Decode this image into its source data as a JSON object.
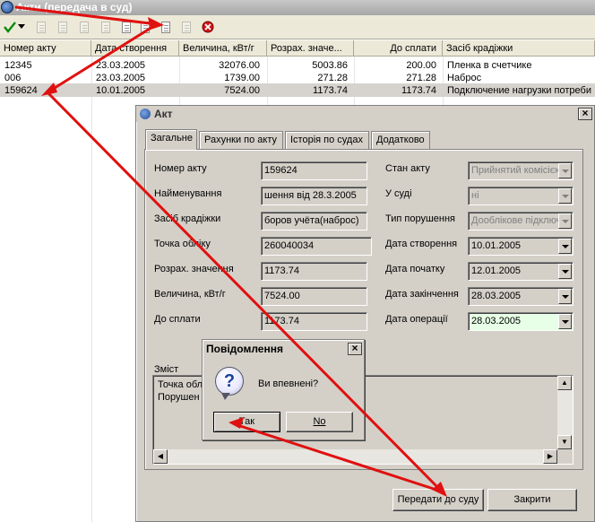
{
  "main_window": {
    "title": "Акти (передача в суд)"
  },
  "toolbar": {
    "icons": [
      "apply-check-icon",
      "chevron-down-icon",
      "new-document-icon",
      "edit-document-icon",
      "copy-document-icon",
      "delete-document-icon",
      "print-icon",
      "refresh-icon",
      "export-icon",
      "properties-icon",
      "close-red-icon"
    ]
  },
  "grid": {
    "columns": [
      "Номер акту",
      "Дата створення",
      "Величина, кВт/г",
      "Розрах. значе...",
      "До сплати",
      "Засіб крадіжки"
    ],
    "rows": [
      [
        "12345",
        "23.03.2005",
        "32076.00",
        "5003.86",
        "200.00",
        "Пленка в счетчике"
      ],
      [
        "006",
        "23.03.2005",
        "1739.00",
        "271.28",
        "271.28",
        "Наброс"
      ],
      [
        "159624",
        "10.01.2005",
        "7524.00",
        "1173.74",
        "1173.74",
        "Подключение нагрузки потреби"
      ]
    ]
  },
  "dialog": {
    "title": "Акт",
    "close": "×",
    "tabs": [
      "Загальне",
      "Рахунки по акту",
      "Історія по судах",
      "Додатково"
    ],
    "left_fields": [
      {
        "label": "Номер акту",
        "value": "159624"
      },
      {
        "label": "Найменування",
        "value": "шення від 28.3.2005"
      },
      {
        "label": "Засіб крадіжки",
        "value": "боров учёта(наброс)"
      },
      {
        "label": "Точка обліку",
        "value": "260040034"
      },
      {
        "label": "Розрах. значення",
        "value": "1173.74"
      },
      {
        "label": "Величина, кВт/г",
        "value": "7524.00"
      },
      {
        "label": "До сплати",
        "value": "1173.74"
      }
    ],
    "right_fields": [
      {
        "label": "Стан акту",
        "value": "Прийнятий комісією"
      },
      {
        "label": "У суді",
        "value": "ні"
      },
      {
        "label": "Тип порушення",
        "value": "Дооблікове підключ"
      },
      {
        "label": "Дата створення",
        "value": "10.01.2005"
      },
      {
        "label": "Дата початку",
        "value": "12.01.2005"
      },
      {
        "label": "Дата закінчення",
        "value": "28.03.2005"
      },
      {
        "label": "Дата операції",
        "value": "28.03.2005"
      }
    ],
    "memo_label": "Зміст",
    "memo_lines": [
      "Точка обл",
      "Порушен"
    ],
    "buttons": {
      "send": "Передати до суду",
      "close": "Закрити"
    }
  },
  "message_box": {
    "title": "Повідомлення",
    "close": "×",
    "question": "Ви впевнені?",
    "yes": "Так",
    "no": "No"
  },
  "colors": {
    "arrow": "#e01010",
    "selected_row": "#d6d3ce",
    "highlight_field": "#e6ffe6"
  }
}
